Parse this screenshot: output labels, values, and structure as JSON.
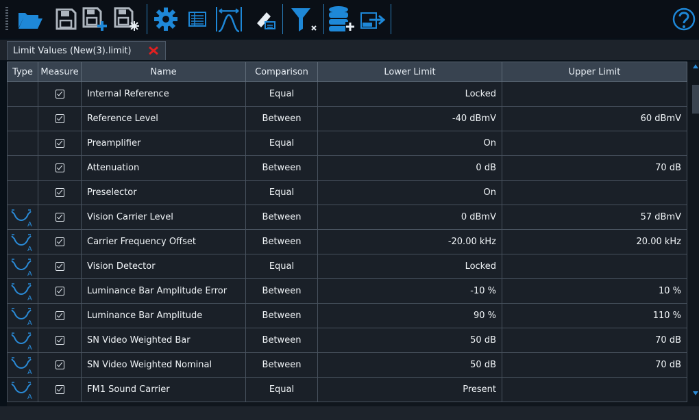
{
  "toolbar": {
    "icons": [
      "open-folder-icon",
      "save-icon",
      "save-as-new-icon",
      "save-all-icon",
      "settings-gear-icon",
      "list-view-icon",
      "spectrum-limit-icon",
      "edit-ruler-icon",
      "filter-clear-icon",
      "database-add-icon",
      "export-csv-icon",
      "help-icon"
    ],
    "accent": "#1e88d8"
  },
  "tab": {
    "label": "Limit Values (New(3).limit)",
    "close_color": "#e02020"
  },
  "table": {
    "columns": [
      "Type",
      "Measure",
      "Name",
      "Comparison",
      "Lower Limit",
      "Upper Limit"
    ],
    "rows": [
      {
        "type": "",
        "measure": true,
        "name": "Internal Reference",
        "comparison": "Equal",
        "lower": "Locked",
        "upper": ""
      },
      {
        "type": "",
        "measure": true,
        "name": "Reference Level",
        "comparison": "Between",
        "lower": "-40 dBmV",
        "upper": "60 dBmV"
      },
      {
        "type": "",
        "measure": true,
        "name": "Preamplifier",
        "comparison": "Equal",
        "lower": "On",
        "upper": ""
      },
      {
        "type": "",
        "measure": true,
        "name": "Attenuation",
        "comparison": "Between",
        "lower": "0 dB",
        "upper": "70 dB"
      },
      {
        "type": "",
        "measure": true,
        "name": "Preselector",
        "comparison": "Equal",
        "lower": "On",
        "upper": ""
      },
      {
        "type": "trace",
        "measure": true,
        "name": "Vision Carrier Level",
        "comparison": "Between",
        "lower": "0 dBmV",
        "upper": "57 dBmV"
      },
      {
        "type": "trace",
        "measure": true,
        "name": "Carrier Frequency Offset",
        "comparison": "Between",
        "lower": "-20.00 kHz",
        "upper": "20.00 kHz"
      },
      {
        "type": "trace",
        "measure": true,
        "name": "Vision Detector",
        "comparison": "Equal",
        "lower": "Locked",
        "upper": ""
      },
      {
        "type": "trace",
        "measure": true,
        "name": "Luminance Bar Amplitude Error",
        "comparison": "Between",
        "lower": "-10 %",
        "upper": "10 %"
      },
      {
        "type": "trace",
        "measure": true,
        "name": "Luminance Bar Amplitude",
        "comparison": "Between",
        "lower": "90 %",
        "upper": "110 %"
      },
      {
        "type": "trace",
        "measure": true,
        "name": "SN Video Weighted Bar",
        "comparison": "Between",
        "lower": "50 dB",
        "upper": "70 dB"
      },
      {
        "type": "trace",
        "measure": true,
        "name": "SN Video Weighted Nominal",
        "comparison": "Between",
        "lower": "50 dB",
        "upper": "70 dB"
      },
      {
        "type": "trace",
        "measure": true,
        "name": "FM1 Sound Carrier",
        "comparison": "Equal",
        "lower": "Present",
        "upper": ""
      }
    ]
  }
}
